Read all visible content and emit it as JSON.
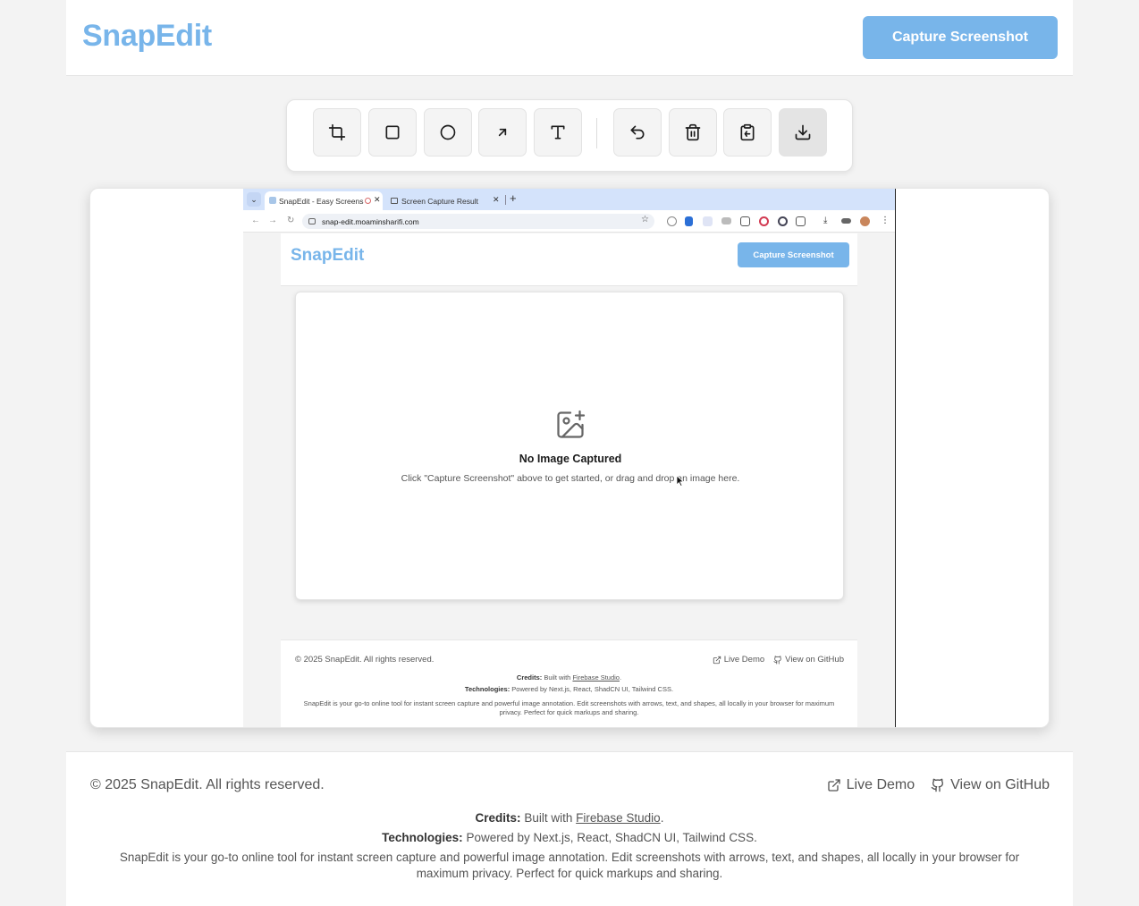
{
  "header": {
    "brand": "SnapEdit",
    "capture_label": "Capture Screenshot"
  },
  "toolbar": {
    "tools": [
      {
        "name": "crop",
        "icon": "crop-icon"
      },
      {
        "name": "rectangle",
        "icon": "square-icon"
      },
      {
        "name": "circle",
        "icon": "circle-icon"
      },
      {
        "name": "arrow",
        "icon": "arrow-up-right-icon"
      },
      {
        "name": "text",
        "icon": "type-icon"
      },
      {
        "name": "undo",
        "icon": "undo-icon"
      },
      {
        "name": "delete",
        "icon": "trash-icon"
      },
      {
        "name": "copy",
        "icon": "clipboard-icon"
      },
      {
        "name": "download",
        "icon": "download-icon"
      }
    ]
  },
  "screenshot": {
    "tabs": [
      {
        "title": "SnapEdit - Easy Screens"
      },
      {
        "title": "Screen Capture Result"
      }
    ],
    "url": "snap-edit.moaminsharifi.com",
    "header": {
      "brand": "SnapEdit",
      "capture_label": "Capture Screenshot"
    },
    "empty": {
      "title": "No Image Captured",
      "text": "Click \"Capture Screenshot\" above to get started, or drag and drop an image here."
    },
    "footer": {
      "copyright": "© 2025 SnapEdit. All rights reserved.",
      "live_demo": "Live Demo",
      "github": "View on GitHub",
      "credits_label": "Credits:",
      "credits_text": "Built with",
      "credits_link": "Firebase Studio",
      "credits_end": ".",
      "tech_label": "Technologies:",
      "tech_text": "Powered by Next.js, React, ShadCN UI, Tailwind CSS.",
      "description": "SnapEdit is your go-to online tool for instant screen capture and powerful image annotation. Edit screenshots with arrows, text, and shapes, all locally in your browser for maximum privacy. Perfect for quick markups and sharing."
    }
  },
  "footer": {
    "copyright": "© 2025 SnapEdit. All rights reserved.",
    "live_demo": "Live Demo",
    "github": "View on GitHub",
    "credits_label": "Credits:",
    "credits_text": "Built with",
    "credits_link": "Firebase Studio",
    "credits_end": ".",
    "tech_label": "Technologies:",
    "tech_text": "Powered by Next.js, React, ShadCN UI, Tailwind CSS.",
    "description": "SnapEdit is your go-to online tool for instant screen capture and powerful image annotation. Edit screenshots with arrows, text, and shapes, all locally in your browser for maximum privacy. Perfect for quick markups and sharing."
  },
  "colors": {
    "accent": "#78b5ea",
    "background": "#f3f3f3"
  }
}
